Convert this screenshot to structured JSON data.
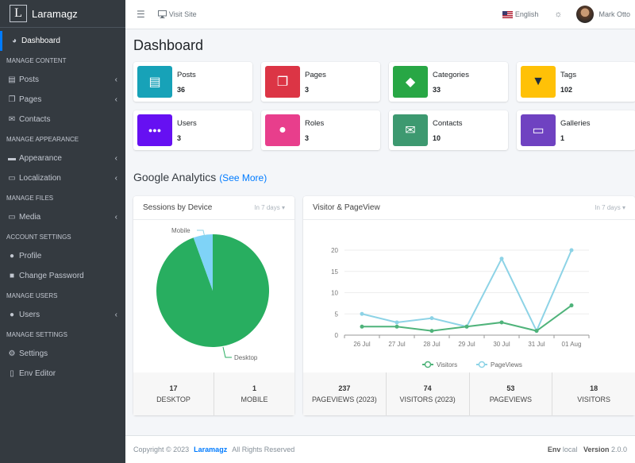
{
  "brand": {
    "logo_letter": "L",
    "name": "Laramagz"
  },
  "sidebar": {
    "items": [
      {
        "type": "item",
        "label": "Dashboard",
        "icon": "tachometer-icon",
        "glyph": "◕",
        "active": true,
        "chevron": false
      },
      {
        "type": "header",
        "label": "MANAGE CONTENT"
      },
      {
        "type": "item",
        "label": "Posts",
        "icon": "book-icon",
        "glyph": "▤",
        "chevron": true
      },
      {
        "type": "item",
        "label": "Pages",
        "icon": "copy-icon",
        "glyph": "❐",
        "chevron": true
      },
      {
        "type": "item",
        "label": "Contacts",
        "icon": "envelope-icon",
        "glyph": "✉",
        "chevron": false
      },
      {
        "type": "header",
        "label": "MANAGE APPEARANCE"
      },
      {
        "type": "item",
        "label": "Appearance",
        "icon": "desktop-icon",
        "glyph": "▬",
        "chevron": true
      },
      {
        "type": "item",
        "label": "Localization",
        "icon": "language-icon",
        "glyph": "▭",
        "chevron": true
      },
      {
        "type": "header",
        "label": "MANAGE FILES"
      },
      {
        "type": "item",
        "label": "Media",
        "icon": "hdd-icon",
        "glyph": "▭",
        "chevron": true
      },
      {
        "type": "header",
        "label": "ACCOUNT SETTINGS"
      },
      {
        "type": "item",
        "label": "Profile",
        "icon": "user-icon",
        "glyph": "●",
        "chevron": false
      },
      {
        "type": "item",
        "label": "Change Password",
        "icon": "lock-icon",
        "glyph": "■",
        "chevron": false
      },
      {
        "type": "header",
        "label": "MANAGE USERS"
      },
      {
        "type": "item",
        "label": "Users",
        "icon": "users-icon",
        "glyph": "●",
        "chevron": true
      },
      {
        "type": "header",
        "label": "MANAGE SETTINGS"
      },
      {
        "type": "item",
        "label": "Settings",
        "icon": "cogs-icon",
        "glyph": "⚙",
        "chevron": false
      },
      {
        "type": "item",
        "label": "Env Editor",
        "icon": "file-icon",
        "glyph": "▯",
        "chevron": false
      }
    ]
  },
  "topbar": {
    "menu_icon": "☰",
    "visit_site": "Visit Site",
    "language": "English",
    "theme_icon": "☼",
    "user_name": "Mark Otto"
  },
  "page": {
    "title": "Dashboard"
  },
  "info_boxes": [
    {
      "label": "Posts",
      "value": "36",
      "color": "#17a2b8",
      "icon": "book-icon",
      "glyph": "▤"
    },
    {
      "label": "Pages",
      "value": "3",
      "color": "#dc3545",
      "icon": "copy-icon",
      "glyph": "❐"
    },
    {
      "label": "Categories",
      "value": "33",
      "color": "#28a745",
      "icon": "tags-icon",
      "glyph": "◆"
    },
    {
      "label": "Tags",
      "value": "102",
      "color": "#ffc107",
      "icon": "thumbtack-icon",
      "glyph": "▼"
    },
    {
      "label": "Users",
      "value": "3",
      "color": "#6610f2",
      "icon": "users-icon",
      "glyph": "●●●"
    },
    {
      "label": "Roles",
      "value": "3",
      "color": "#e83e8c",
      "icon": "user-shield-icon",
      "glyph": "●"
    },
    {
      "label": "Contacts",
      "value": "10",
      "color": "#3d9970",
      "icon": "envelope-icon",
      "glyph": "✉"
    },
    {
      "label": "Galleries",
      "value": "1",
      "color": "#6f42c1",
      "icon": "hdd-icon",
      "glyph": "▭"
    }
  ],
  "analytics": {
    "title": "Google Analytics",
    "see_more": "(See More)",
    "sessions": {
      "title": "Sessions by Device",
      "range": "In 7 days",
      "stats": [
        {
          "value": "17",
          "label": "DESKTOP"
        },
        {
          "value": "1",
          "label": "MOBILE"
        }
      ]
    },
    "visitors": {
      "title": "Visitor & PageView",
      "range": "In 7 days",
      "stats": [
        {
          "value": "237",
          "label": "PAGEVIEWS (2023)"
        },
        {
          "value": "74",
          "label": "VISITORS (2023)"
        },
        {
          "value": "53",
          "label": "PAGEVIEWS"
        },
        {
          "value": "18",
          "label": "VISITORS"
        }
      ]
    }
  },
  "chart_data": [
    {
      "type": "pie",
      "title": "Sessions by Device",
      "categories": [
        "Desktop",
        "Mobile"
      ],
      "values": [
        17,
        1
      ],
      "colors": [
        "#28ae60",
        "#7fd3f7"
      ]
    },
    {
      "type": "line",
      "title": "Visitor & PageView",
      "categories": [
        "26 Jul",
        "27 Jul",
        "28 Jul",
        "29 Jul",
        "30 Jul",
        "31 Jul",
        "01 Aug"
      ],
      "series": [
        {
          "name": "Visitors",
          "values": [
            2,
            2,
            1,
            2,
            3,
            1,
            7
          ],
          "color": "#4fb37a"
        },
        {
          "name": "PageViews",
          "values": [
            5,
            3,
            4,
            2,
            18,
            1,
            20
          ],
          "color": "#8dd3e6"
        }
      ],
      "yticks": [
        0,
        5,
        10,
        15,
        20
      ],
      "ylim": [
        0,
        20
      ],
      "grid": true,
      "legend": "bottom"
    }
  ],
  "footer": {
    "copyright": "Copyright © 2023",
    "brand": "Laramagz",
    "rights": "All Rights Reserved",
    "env_label": "Env",
    "env_value": "local",
    "version_label": "Version",
    "version_value": "2.0.0"
  }
}
